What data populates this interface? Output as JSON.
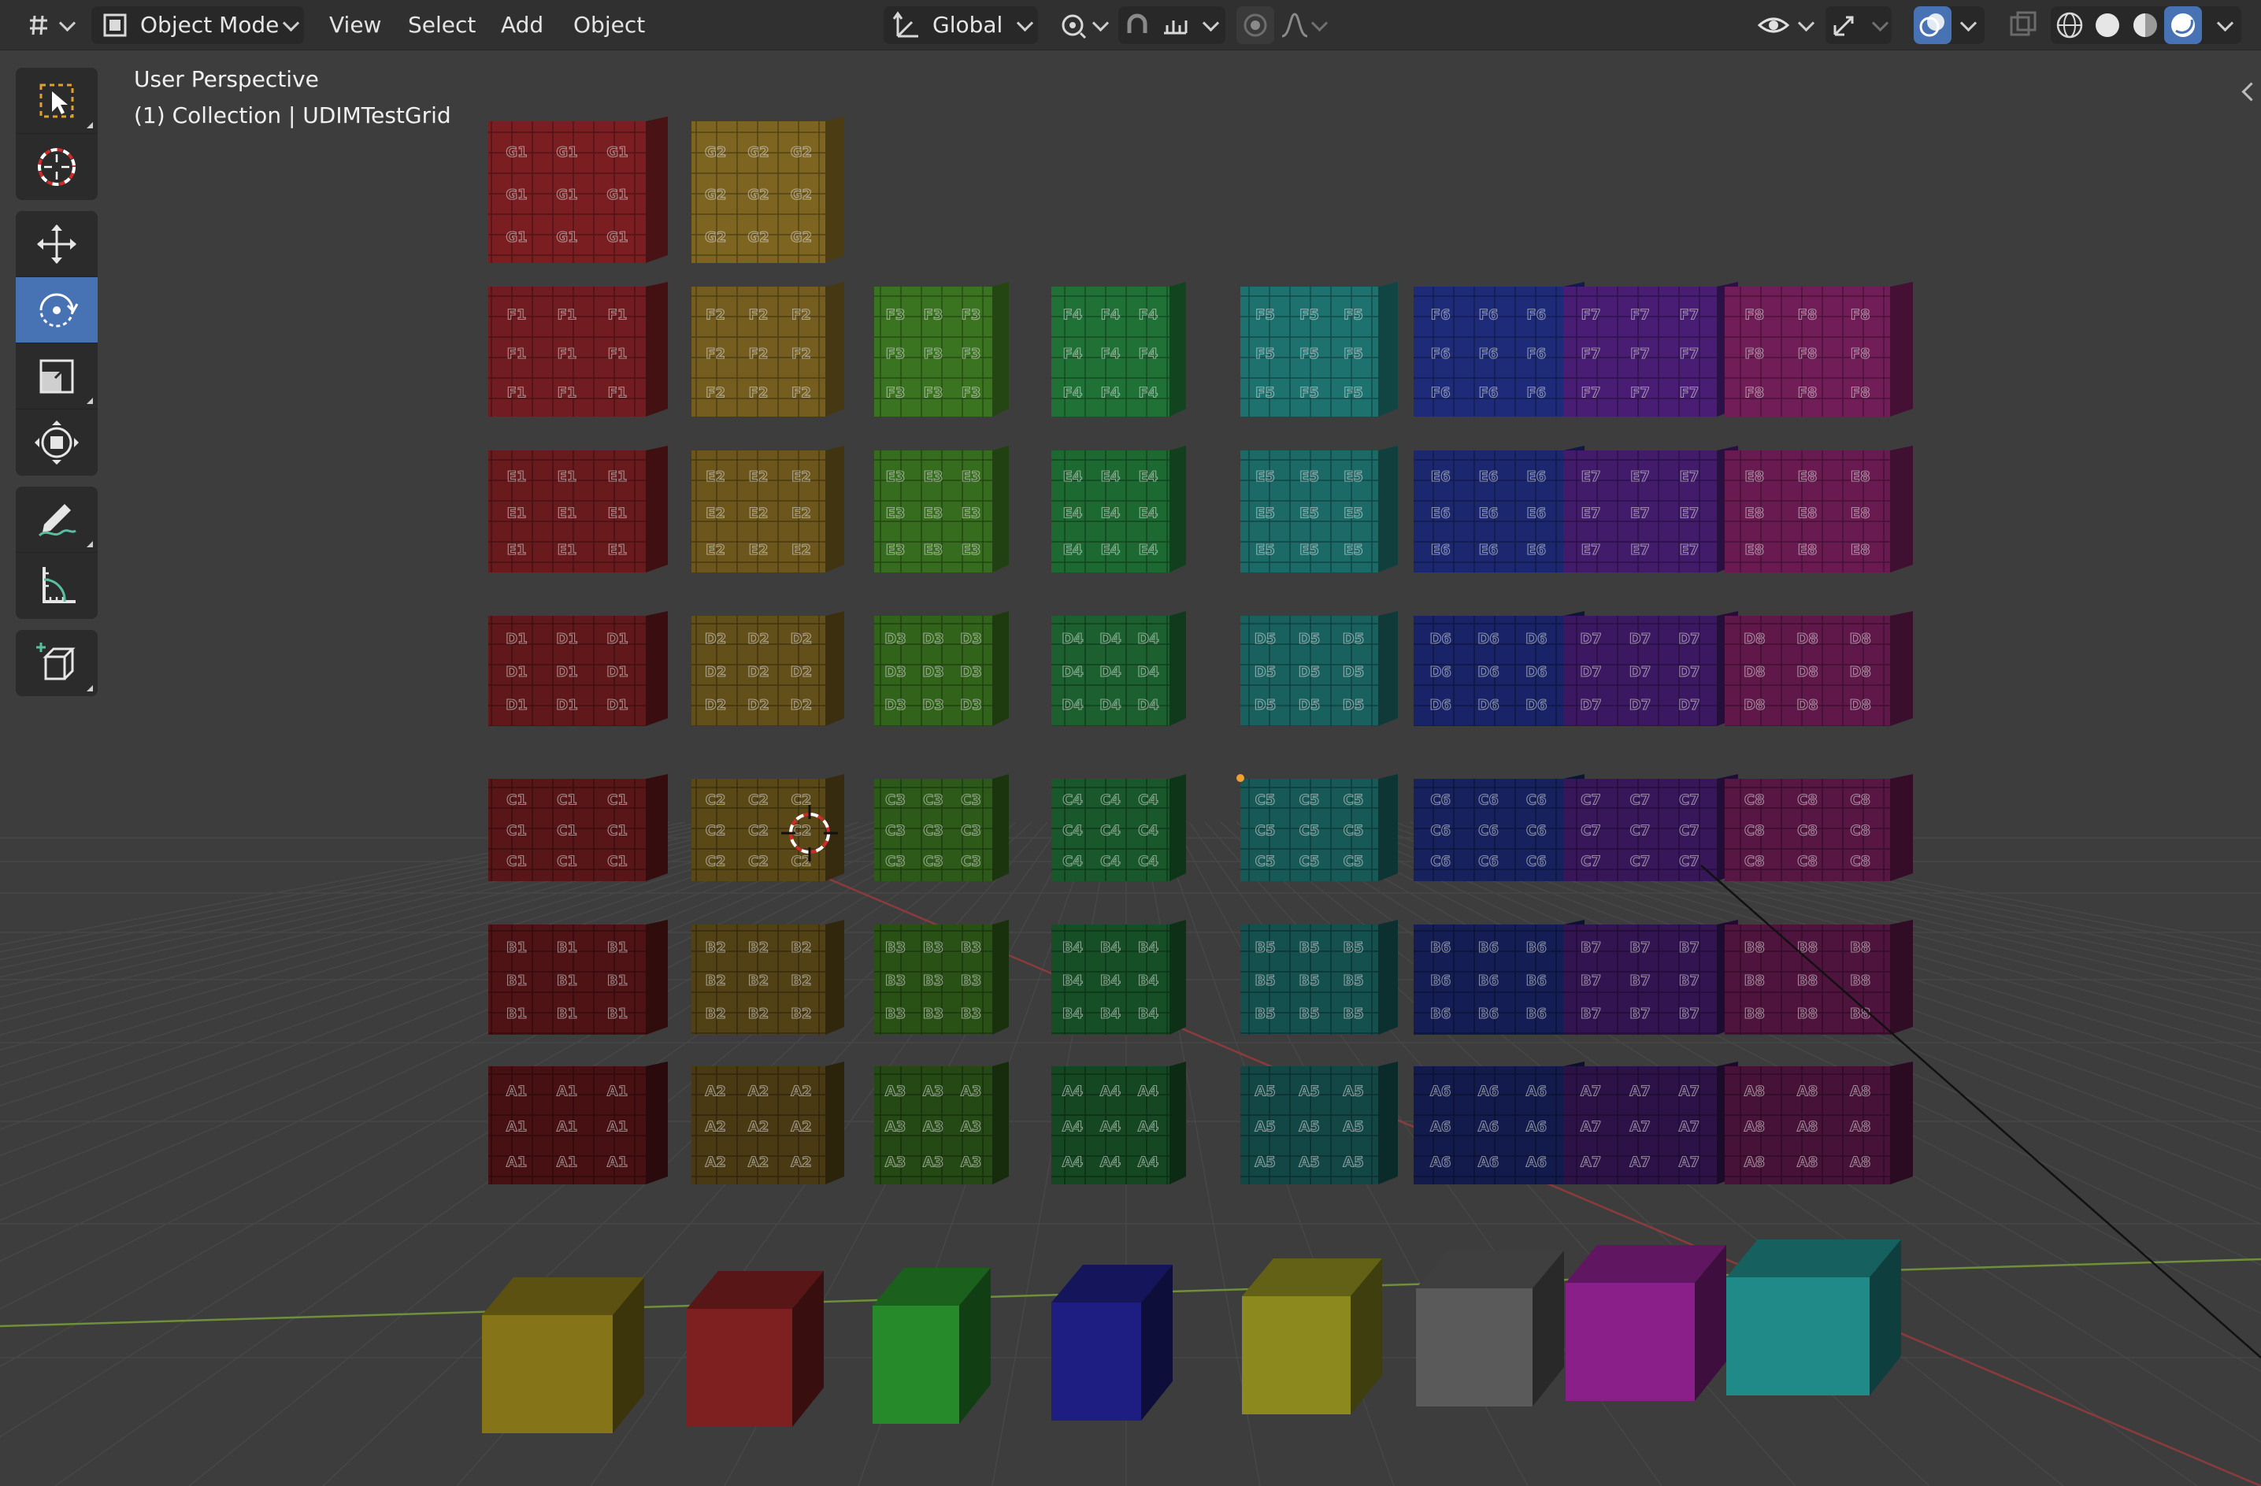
{
  "header": {
    "editor_type_icon": "grid-editor-icon",
    "mode_label": "Object Mode",
    "menus": [
      "View",
      "Select",
      "Add",
      "Object"
    ],
    "transform_orientation": "Global",
    "pivot_icon": "pivot-point-icon",
    "snap_icon": "snap-magnet-icon",
    "snap_increment_icon": "snap-increment-icon",
    "proportional_icon": "proportional-edit-icon",
    "falloff_icon": "falloff-curve-icon",
    "visibility_icon": "eye-icon",
    "gizmo_icon": "gizmo-icon",
    "overlay_icon": "overlay-icon",
    "xray_icon": "xray-icon",
    "shading_modes": [
      "wireframe",
      "solid",
      "material-preview",
      "rendered"
    ],
    "active_shading": "rendered"
  },
  "viewport": {
    "view_name": "User Perspective",
    "collection_info": "(1) Collection | UDIMTestGrid"
  },
  "toolbar": {
    "tools": [
      "select-box",
      "cursor",
      "move",
      "rotate",
      "scale",
      "transform",
      "annotate",
      "measure",
      "add-cube"
    ],
    "active_tool": "rotate"
  },
  "scene": {
    "column_colors": [
      "#7a1e22",
      "#7d6420",
      "#3f7d22",
      "#227a3a",
      "#1f7b78",
      "#1f2e82",
      "#4d1f7c",
      "#7a1f5e"
    ],
    "row_labels": [
      "G",
      "F",
      "E",
      "D",
      "C",
      "B",
      "A"
    ],
    "grid_labels": [
      [
        "G1",
        "G2",
        "",
        "",
        "",
        "",
        "",
        ""
      ],
      [
        "F1",
        "F2",
        "F3",
        "F4",
        "F5",
        "F6",
        "F7",
        "F8"
      ],
      [
        "E1",
        "E2",
        "E3",
        "E4",
        "E5",
        "E6",
        "E7",
        "E8"
      ],
      [
        "D1",
        "D2",
        "D3",
        "D4",
        "D5",
        "D6",
        "D7",
        "D8"
      ],
      [
        "C1",
        "C2",
        "C3",
        "C4",
        "C5",
        "C6",
        "C7",
        "C8"
      ],
      [
        "B1",
        "B2",
        "B3",
        "B4",
        "B5",
        "B6",
        "B7",
        "B8"
      ],
      [
        "A1",
        "A2",
        "A3",
        "A4",
        "A5",
        "A6",
        "A7",
        "A8"
      ]
    ],
    "bottom_cube_colors": [
      "#857418",
      "#7e1f20",
      "#268a2a",
      "#1e1e82",
      "#8c8a1e",
      "#5a5a5a",
      "#8a1f8a",
      "#1f8a88"
    ]
  }
}
